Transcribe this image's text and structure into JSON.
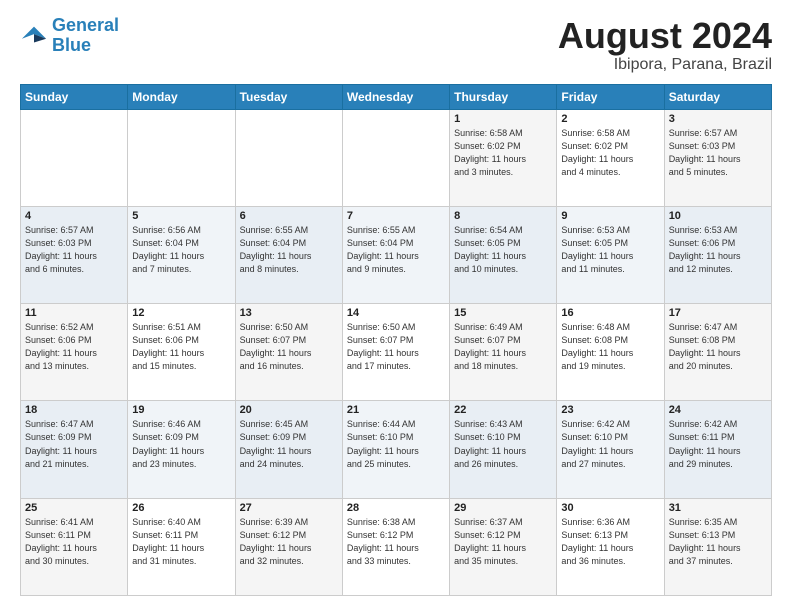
{
  "header": {
    "logo_line1": "General",
    "logo_line2": "Blue",
    "month_title": "August 2024",
    "subtitle": "Ibipora, Parana, Brazil"
  },
  "weekdays": [
    "Sunday",
    "Monday",
    "Tuesday",
    "Wednesday",
    "Thursday",
    "Friday",
    "Saturday"
  ],
  "weeks": [
    [
      {
        "day": "",
        "info": ""
      },
      {
        "day": "",
        "info": ""
      },
      {
        "day": "",
        "info": ""
      },
      {
        "day": "",
        "info": ""
      },
      {
        "day": "1",
        "info": "Sunrise: 6:58 AM\nSunset: 6:02 PM\nDaylight: 11 hours\nand 3 minutes."
      },
      {
        "day": "2",
        "info": "Sunrise: 6:58 AM\nSunset: 6:02 PM\nDaylight: 11 hours\nand 4 minutes."
      },
      {
        "day": "3",
        "info": "Sunrise: 6:57 AM\nSunset: 6:03 PM\nDaylight: 11 hours\nand 5 minutes."
      }
    ],
    [
      {
        "day": "4",
        "info": "Sunrise: 6:57 AM\nSunset: 6:03 PM\nDaylight: 11 hours\nand 6 minutes."
      },
      {
        "day": "5",
        "info": "Sunrise: 6:56 AM\nSunset: 6:04 PM\nDaylight: 11 hours\nand 7 minutes."
      },
      {
        "day": "6",
        "info": "Sunrise: 6:55 AM\nSunset: 6:04 PM\nDaylight: 11 hours\nand 8 minutes."
      },
      {
        "day": "7",
        "info": "Sunrise: 6:55 AM\nSunset: 6:04 PM\nDaylight: 11 hours\nand 9 minutes."
      },
      {
        "day": "8",
        "info": "Sunrise: 6:54 AM\nSunset: 6:05 PM\nDaylight: 11 hours\nand 10 minutes."
      },
      {
        "day": "9",
        "info": "Sunrise: 6:53 AM\nSunset: 6:05 PM\nDaylight: 11 hours\nand 11 minutes."
      },
      {
        "day": "10",
        "info": "Sunrise: 6:53 AM\nSunset: 6:06 PM\nDaylight: 11 hours\nand 12 minutes."
      }
    ],
    [
      {
        "day": "11",
        "info": "Sunrise: 6:52 AM\nSunset: 6:06 PM\nDaylight: 11 hours\nand 13 minutes."
      },
      {
        "day": "12",
        "info": "Sunrise: 6:51 AM\nSunset: 6:06 PM\nDaylight: 11 hours\nand 15 minutes."
      },
      {
        "day": "13",
        "info": "Sunrise: 6:50 AM\nSunset: 6:07 PM\nDaylight: 11 hours\nand 16 minutes."
      },
      {
        "day": "14",
        "info": "Sunrise: 6:50 AM\nSunset: 6:07 PM\nDaylight: 11 hours\nand 17 minutes."
      },
      {
        "day": "15",
        "info": "Sunrise: 6:49 AM\nSunset: 6:07 PM\nDaylight: 11 hours\nand 18 minutes."
      },
      {
        "day": "16",
        "info": "Sunrise: 6:48 AM\nSunset: 6:08 PM\nDaylight: 11 hours\nand 19 minutes."
      },
      {
        "day": "17",
        "info": "Sunrise: 6:47 AM\nSunset: 6:08 PM\nDaylight: 11 hours\nand 20 minutes."
      }
    ],
    [
      {
        "day": "18",
        "info": "Sunrise: 6:47 AM\nSunset: 6:09 PM\nDaylight: 11 hours\nand 21 minutes."
      },
      {
        "day": "19",
        "info": "Sunrise: 6:46 AM\nSunset: 6:09 PM\nDaylight: 11 hours\nand 23 minutes."
      },
      {
        "day": "20",
        "info": "Sunrise: 6:45 AM\nSunset: 6:09 PM\nDaylight: 11 hours\nand 24 minutes."
      },
      {
        "day": "21",
        "info": "Sunrise: 6:44 AM\nSunset: 6:10 PM\nDaylight: 11 hours\nand 25 minutes."
      },
      {
        "day": "22",
        "info": "Sunrise: 6:43 AM\nSunset: 6:10 PM\nDaylight: 11 hours\nand 26 minutes."
      },
      {
        "day": "23",
        "info": "Sunrise: 6:42 AM\nSunset: 6:10 PM\nDaylight: 11 hours\nand 27 minutes."
      },
      {
        "day": "24",
        "info": "Sunrise: 6:42 AM\nSunset: 6:11 PM\nDaylight: 11 hours\nand 29 minutes."
      }
    ],
    [
      {
        "day": "25",
        "info": "Sunrise: 6:41 AM\nSunset: 6:11 PM\nDaylight: 11 hours\nand 30 minutes."
      },
      {
        "day": "26",
        "info": "Sunrise: 6:40 AM\nSunset: 6:11 PM\nDaylight: 11 hours\nand 31 minutes."
      },
      {
        "day": "27",
        "info": "Sunrise: 6:39 AM\nSunset: 6:12 PM\nDaylight: 11 hours\nand 32 minutes."
      },
      {
        "day": "28",
        "info": "Sunrise: 6:38 AM\nSunset: 6:12 PM\nDaylight: 11 hours\nand 33 minutes."
      },
      {
        "day": "29",
        "info": "Sunrise: 6:37 AM\nSunset: 6:12 PM\nDaylight: 11 hours\nand 35 minutes."
      },
      {
        "day": "30",
        "info": "Sunrise: 6:36 AM\nSunset: 6:13 PM\nDaylight: 11 hours\nand 36 minutes."
      },
      {
        "day": "31",
        "info": "Sunrise: 6:35 AM\nSunset: 6:13 PM\nDaylight: 11 hours\nand 37 minutes."
      }
    ]
  ]
}
